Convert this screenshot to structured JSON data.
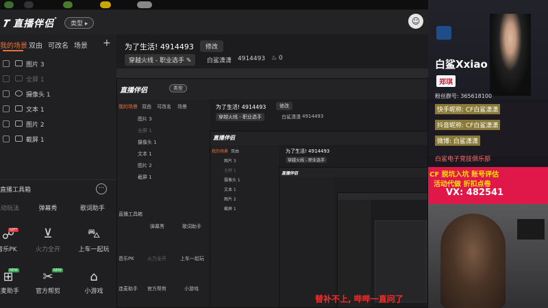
{
  "app": {
    "logo": "直播伴侣",
    "type_pill": "类型"
  },
  "scene_tabs": [
    "我的场景",
    "双由",
    "可改名",
    "场景"
  ],
  "scenes": [
    {
      "label": "图片 3",
      "dim": false
    },
    {
      "label": "全屏 1",
      "dim": true
    },
    {
      "label": "摄像头 1",
      "dim": false
    },
    {
      "label": "文本 1",
      "dim": false
    },
    {
      "label": "图片 2",
      "dim": false
    },
    {
      "label": "截屏 1",
      "dim": false
    }
  ],
  "tools": {
    "title": "直播工具箱",
    "row1": [
      "互动玩法",
      "弹幕秀",
      "歌词助手"
    ],
    "row2": [
      "音乐PK",
      "火力全开",
      "上车一起玩"
    ],
    "row3": [
      "连麦助手",
      "官方帮剪",
      "小游戏"
    ]
  },
  "broadcast": {
    "title": "为了生活!",
    "room_id": "4914493",
    "edit": "修改",
    "category": "穿越火线 - 职业选手",
    "streamer": "白鲨潇潇",
    "room_id2": "4914493",
    "heat": "0"
  },
  "stream": {
    "club_name": "白鲨Xxiao",
    "player_name": "郑琪",
    "fan_group": "粉丝群号: 365618100",
    "kuaishou": "快手昵称: CF白鲨潇潇",
    "douyin": "抖音昵称: CF白鲨潇潇",
    "weibo": "微博: 白鲨潇潇",
    "club": "白鲨电子竞技俱乐部",
    "promo_line1": "CF 脱坑入坑 账号评估",
    "promo_line2": "活动代做  折扣点卷",
    "vx": "VX: 482541",
    "subtitle": "替补不上, 哔哔一直问了"
  },
  "colors": {
    "accent": "#e8733a",
    "promo_red": "#e0184a",
    "subtitle_red": "#ff2a2a"
  }
}
